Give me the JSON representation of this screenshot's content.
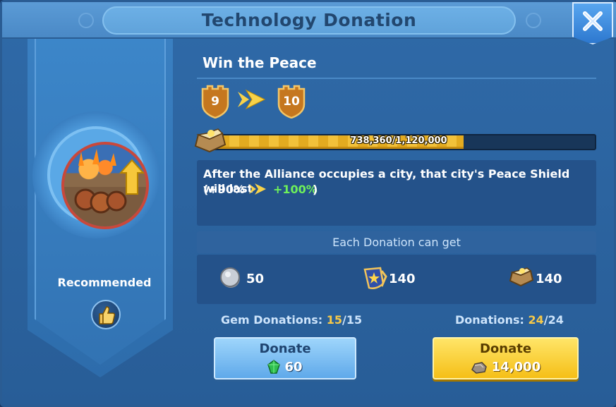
{
  "window": {
    "title": "Technology Donation",
    "close_icon": "close-icon"
  },
  "technology": {
    "name": "Win the Peace",
    "recommended_label": "Recommended",
    "current_level": "9",
    "next_level": "10",
    "progress": {
      "current": 738360,
      "max": 1120000,
      "text": "738,360/1,120,000"
    },
    "effect": {
      "line1": "After the Alliance occupies a city, that city's Peace Shield will last",
      "current_prefix": "(+90%",
      "next_value": "+100%",
      "suffix": ")"
    }
  },
  "rewards": {
    "header": "Each Donation can get",
    "items": [
      {
        "icon": "silver-coin-icon",
        "amount": "50"
      },
      {
        "icon": "alliance-credit-icon",
        "amount": "140"
      },
      {
        "icon": "tech-book-icon",
        "amount": "140"
      }
    ]
  },
  "donations": {
    "gem": {
      "label_prefix": "Gem Donations: ",
      "current": "15",
      "max": "/15",
      "button_label": "Donate",
      "cost": "60",
      "cost_icon": "gem-icon"
    },
    "resource": {
      "label_prefix": "Donations: ",
      "current": "24",
      "max": "/24",
      "button_label": "Donate",
      "cost": "14,000",
      "cost_icon": "stone-icon"
    }
  },
  "colors": {
    "panel_blue": "#2f6aa8",
    "progress_gold": "#f2c13a",
    "bonus_green": "#6ef05a",
    "count_gold": "#f7c948"
  }
}
